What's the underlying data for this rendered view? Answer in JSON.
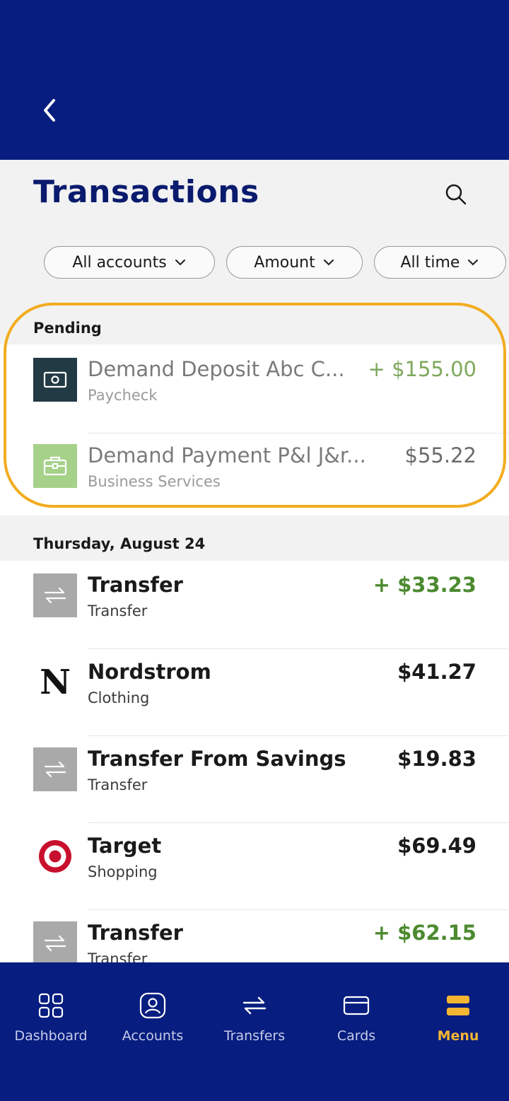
{
  "header": {
    "back_icon": "chevron-left-icon",
    "title": "Transactions",
    "search_icon": "search-icon"
  },
  "filters": [
    {
      "label": "All accounts",
      "icon": "chevron-down-icon"
    },
    {
      "label": "Amount",
      "icon": "chevron-down-icon"
    },
    {
      "label": "All time",
      "icon": "chevron-down-icon"
    }
  ],
  "pending": {
    "label": "Pending",
    "items": [
      {
        "name": "Demand Deposit Abc C...",
        "category": "Paycheck",
        "amount": "+ $155.00",
        "icon": "cash-icon"
      },
      {
        "name": "Demand Payment P&l J&r...",
        "category": "Business Services",
        "amount": "$55.22",
        "icon": "briefcase-icon"
      }
    ]
  },
  "groups": [
    {
      "date": "Thursday, August 24",
      "items": [
        {
          "name": "Transfer",
          "category": "Transfer",
          "amount": "+ $33.23",
          "icon": "transfer-icon"
        },
        {
          "name": "Nordstrom",
          "category": "Clothing",
          "amount": "$41.27",
          "icon": "nordstrom-logo",
          "logo_text": "N"
        },
        {
          "name": "Transfer From Savings",
          "category": "Transfer",
          "amount": "$19.83",
          "icon": "transfer-icon"
        },
        {
          "name": "Target",
          "category": "Shopping",
          "amount": "$69.49",
          "icon": "target-logo"
        },
        {
          "name": "Transfer",
          "category": "Transfer",
          "amount": "+ $62.15",
          "icon": "transfer-icon"
        }
      ]
    }
  ],
  "nav": [
    {
      "label": "Dashboard",
      "icon": "dashboard-icon"
    },
    {
      "label": "Accounts",
      "icon": "accounts-icon"
    },
    {
      "label": "Transfers",
      "icon": "transfers-icon"
    },
    {
      "label": "Cards",
      "icon": "card-icon"
    },
    {
      "label": "Menu",
      "icon": "menu-icon",
      "active": true
    }
  ],
  "colors": {
    "brand_navy": "#071d7f",
    "title_navy": "#0a1b6e",
    "credit_green": "#4c8a2f",
    "highlight_orange": "#f2ac20",
    "menu_active": "#f5b632"
  }
}
